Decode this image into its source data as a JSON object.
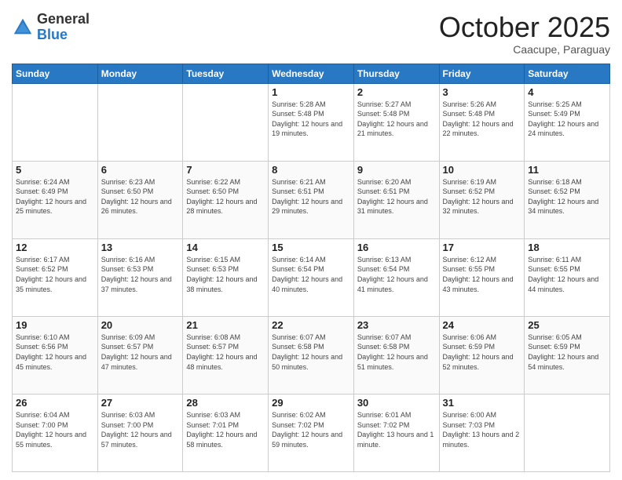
{
  "header": {
    "logo": {
      "general": "General",
      "blue": "Blue"
    },
    "title": "October 2025",
    "subtitle": "Caacupe, Paraguay"
  },
  "days_of_week": [
    "Sunday",
    "Monday",
    "Tuesday",
    "Wednesday",
    "Thursday",
    "Friday",
    "Saturday"
  ],
  "weeks": [
    [
      {
        "day": "",
        "info": ""
      },
      {
        "day": "",
        "info": ""
      },
      {
        "day": "",
        "info": ""
      },
      {
        "day": "1",
        "info": "Sunrise: 5:28 AM\nSunset: 5:48 PM\nDaylight: 12 hours and 19 minutes."
      },
      {
        "day": "2",
        "info": "Sunrise: 5:27 AM\nSunset: 5:48 PM\nDaylight: 12 hours and 21 minutes."
      },
      {
        "day": "3",
        "info": "Sunrise: 5:26 AM\nSunset: 5:48 PM\nDaylight: 12 hours and 22 minutes."
      },
      {
        "day": "4",
        "info": "Sunrise: 5:25 AM\nSunset: 5:49 PM\nDaylight: 12 hours and 24 minutes."
      }
    ],
    [
      {
        "day": "5",
        "info": "Sunrise: 6:24 AM\nSunset: 6:49 PM\nDaylight: 12 hours and 25 minutes."
      },
      {
        "day": "6",
        "info": "Sunrise: 6:23 AM\nSunset: 6:50 PM\nDaylight: 12 hours and 26 minutes."
      },
      {
        "day": "7",
        "info": "Sunrise: 6:22 AM\nSunset: 6:50 PM\nDaylight: 12 hours and 28 minutes."
      },
      {
        "day": "8",
        "info": "Sunrise: 6:21 AM\nSunset: 6:51 PM\nDaylight: 12 hours and 29 minutes."
      },
      {
        "day": "9",
        "info": "Sunrise: 6:20 AM\nSunset: 6:51 PM\nDaylight: 12 hours and 31 minutes."
      },
      {
        "day": "10",
        "info": "Sunrise: 6:19 AM\nSunset: 6:52 PM\nDaylight: 12 hours and 32 minutes."
      },
      {
        "day": "11",
        "info": "Sunrise: 6:18 AM\nSunset: 6:52 PM\nDaylight: 12 hours and 34 minutes."
      }
    ],
    [
      {
        "day": "12",
        "info": "Sunrise: 6:17 AM\nSunset: 6:52 PM\nDaylight: 12 hours and 35 minutes."
      },
      {
        "day": "13",
        "info": "Sunrise: 6:16 AM\nSunset: 6:53 PM\nDaylight: 12 hours and 37 minutes."
      },
      {
        "day": "14",
        "info": "Sunrise: 6:15 AM\nSunset: 6:53 PM\nDaylight: 12 hours and 38 minutes."
      },
      {
        "day": "15",
        "info": "Sunrise: 6:14 AM\nSunset: 6:54 PM\nDaylight: 12 hours and 40 minutes."
      },
      {
        "day": "16",
        "info": "Sunrise: 6:13 AM\nSunset: 6:54 PM\nDaylight: 12 hours and 41 minutes."
      },
      {
        "day": "17",
        "info": "Sunrise: 6:12 AM\nSunset: 6:55 PM\nDaylight: 12 hours and 43 minutes."
      },
      {
        "day": "18",
        "info": "Sunrise: 6:11 AM\nSunset: 6:55 PM\nDaylight: 12 hours and 44 minutes."
      }
    ],
    [
      {
        "day": "19",
        "info": "Sunrise: 6:10 AM\nSunset: 6:56 PM\nDaylight: 12 hours and 45 minutes."
      },
      {
        "day": "20",
        "info": "Sunrise: 6:09 AM\nSunset: 6:57 PM\nDaylight: 12 hours and 47 minutes."
      },
      {
        "day": "21",
        "info": "Sunrise: 6:08 AM\nSunset: 6:57 PM\nDaylight: 12 hours and 48 minutes."
      },
      {
        "day": "22",
        "info": "Sunrise: 6:07 AM\nSunset: 6:58 PM\nDaylight: 12 hours and 50 minutes."
      },
      {
        "day": "23",
        "info": "Sunrise: 6:07 AM\nSunset: 6:58 PM\nDaylight: 12 hours and 51 minutes."
      },
      {
        "day": "24",
        "info": "Sunrise: 6:06 AM\nSunset: 6:59 PM\nDaylight: 12 hours and 52 minutes."
      },
      {
        "day": "25",
        "info": "Sunrise: 6:05 AM\nSunset: 6:59 PM\nDaylight: 12 hours and 54 minutes."
      }
    ],
    [
      {
        "day": "26",
        "info": "Sunrise: 6:04 AM\nSunset: 7:00 PM\nDaylight: 12 hours and 55 minutes."
      },
      {
        "day": "27",
        "info": "Sunrise: 6:03 AM\nSunset: 7:00 PM\nDaylight: 12 hours and 57 minutes."
      },
      {
        "day": "28",
        "info": "Sunrise: 6:03 AM\nSunset: 7:01 PM\nDaylight: 12 hours and 58 minutes."
      },
      {
        "day": "29",
        "info": "Sunrise: 6:02 AM\nSunset: 7:02 PM\nDaylight: 12 hours and 59 minutes."
      },
      {
        "day": "30",
        "info": "Sunrise: 6:01 AM\nSunset: 7:02 PM\nDaylight: 13 hours and 1 minute."
      },
      {
        "day": "31",
        "info": "Sunrise: 6:00 AM\nSunset: 7:03 PM\nDaylight: 13 hours and 2 minutes."
      },
      {
        "day": "",
        "info": ""
      }
    ]
  ]
}
